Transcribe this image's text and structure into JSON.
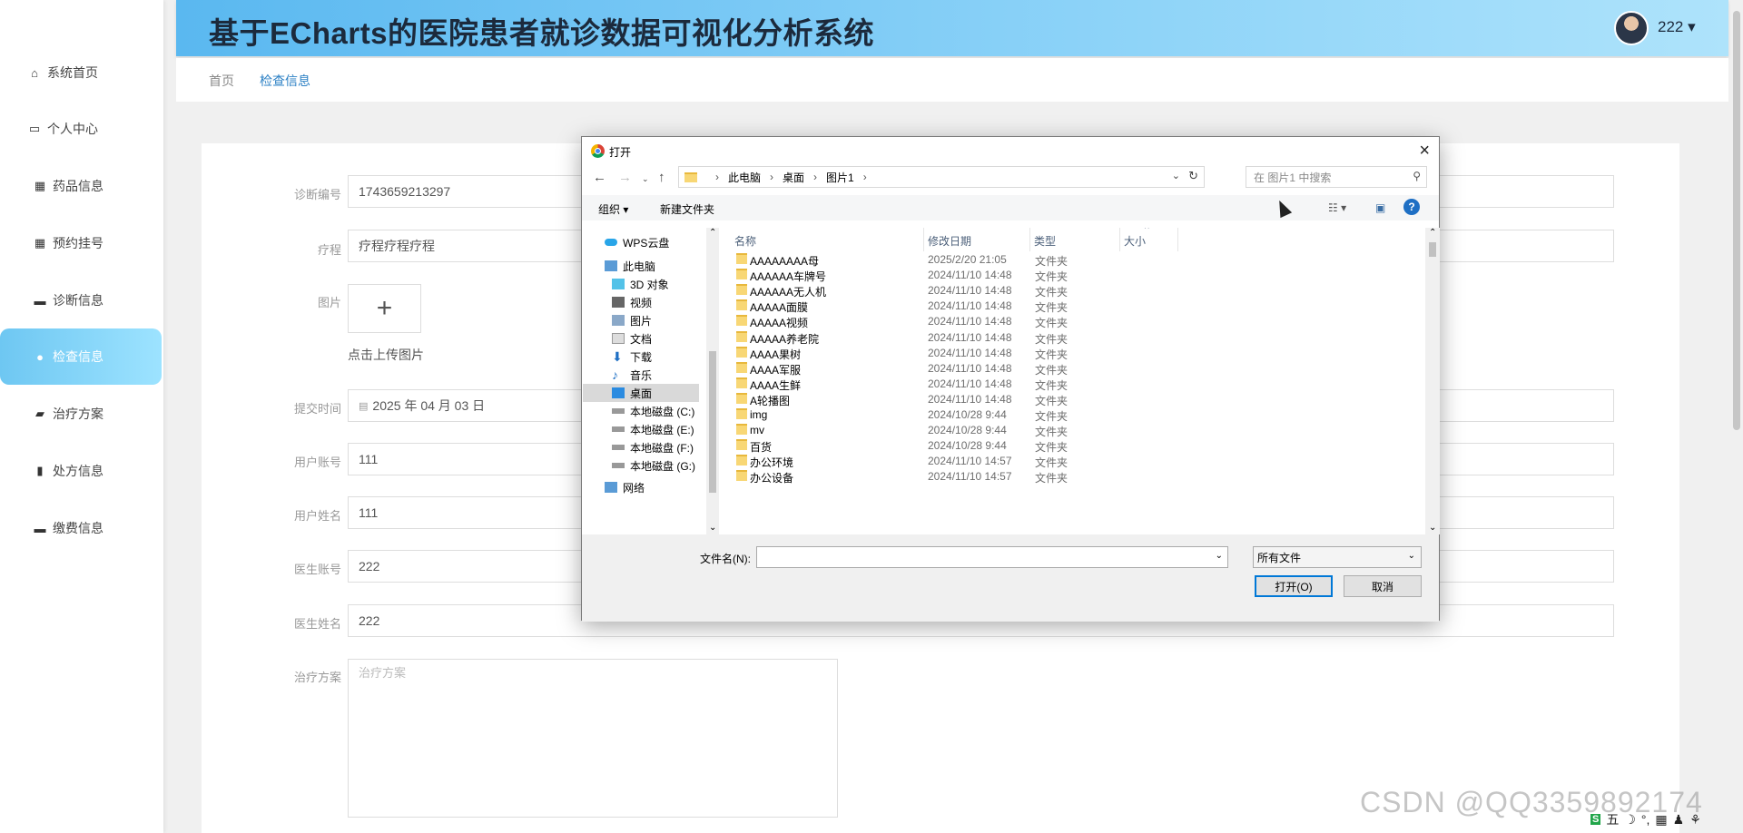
{
  "app": {
    "title": "基于ECharts的医院患者就诊数据可视化分析系统",
    "user": "222 ▾"
  },
  "sidebar": {
    "items": [
      {
        "label": "系统首页",
        "icon": "home-icon"
      },
      {
        "label": "个人中心",
        "icon": "id-card-icon"
      },
      {
        "label": "药品信息",
        "icon": "grid-icon"
      },
      {
        "label": "预约挂号",
        "icon": "grid-icon"
      },
      {
        "label": "诊断信息",
        "icon": "monitor-icon"
      },
      {
        "label": "检查信息",
        "icon": "user-icon",
        "active": true
      },
      {
        "label": "治疗方案",
        "icon": "briefcase-icon"
      },
      {
        "label": "处方信息",
        "icon": "clipboard-icon"
      },
      {
        "label": "缴费信息",
        "icon": "monitor-icon"
      }
    ]
  },
  "breadcrumb": {
    "home": "首页",
    "current": "检查信息"
  },
  "form": {
    "diagnosis_no": {
      "label": "诊断编号",
      "value": "1743659213297"
    },
    "course": {
      "label": "疗程",
      "value": "疗程疗程疗程"
    },
    "image": {
      "label": "图片",
      "plus": "+",
      "tip": "点击上传图片"
    },
    "submit_time": {
      "label": "提交时间",
      "value": "2025 年 04 月 03 日"
    },
    "user_account": {
      "label": "用户账号",
      "value": "111"
    },
    "user_name": {
      "label": "用户姓名",
      "value": "111"
    },
    "doctor_account": {
      "label": "医生账号",
      "value": "222"
    },
    "doctor_name": {
      "label": "医生姓名",
      "value": "222"
    },
    "plan": {
      "label": "治疗方案",
      "placeholder": "治疗方案"
    }
  },
  "dialog": {
    "title": "打开",
    "path": [
      "此电脑",
      "桌面",
      "图片1"
    ],
    "search_placeholder": "在 图片1 中搜索",
    "toolbar": {
      "organize": "组织 ▾",
      "new_folder": "新建文件夹"
    },
    "tree": [
      {
        "label": "WPS云盘",
        "icon": "cloud-icon"
      },
      {
        "label": "此电脑",
        "icon": "computer-icon"
      },
      {
        "label": "3D 对象",
        "icon": "cube-icon"
      },
      {
        "label": "视频",
        "icon": "video-icon"
      },
      {
        "label": "图片",
        "icon": "image-icon"
      },
      {
        "label": "文档",
        "icon": "document-icon"
      },
      {
        "label": "下载",
        "icon": "download-icon"
      },
      {
        "label": "音乐",
        "icon": "music-icon"
      },
      {
        "label": "桌面",
        "icon": "desktop-icon",
        "selected": true
      },
      {
        "label": "本地磁盘 (C:)",
        "icon": "disk-icon"
      },
      {
        "label": "本地磁盘 (E:)",
        "icon": "disk-icon"
      },
      {
        "label": "本地磁盘 (F:)",
        "icon": "disk-icon"
      },
      {
        "label": "本地磁盘 (G:)",
        "icon": "disk-icon"
      },
      {
        "label": "网络",
        "icon": "network-icon"
      }
    ],
    "columns": {
      "name": "名称",
      "date": "修改日期",
      "type": "类型",
      "size": "大小"
    },
    "files": [
      {
        "name": "AAAAAAAA母",
        "date": "2025/2/20 21:05",
        "type": "文件夹"
      },
      {
        "name": "AAAAAA车牌号",
        "date": "2024/11/10 14:48",
        "type": "文件夹"
      },
      {
        "name": "AAAAAA无人机",
        "date": "2024/11/10 14:48",
        "type": "文件夹"
      },
      {
        "name": "AAAAA面膜",
        "date": "2024/11/10 14:48",
        "type": "文件夹"
      },
      {
        "name": "AAAAA视频",
        "date": "2024/11/10 14:48",
        "type": "文件夹"
      },
      {
        "name": "AAAAA养老院",
        "date": "2024/11/10 14:48",
        "type": "文件夹"
      },
      {
        "name": "AAAA果树",
        "date": "2024/11/10 14:48",
        "type": "文件夹"
      },
      {
        "name": "AAAA军服",
        "date": "2024/11/10 14:48",
        "type": "文件夹"
      },
      {
        "name": "AAAA生鲜",
        "date": "2024/11/10 14:48",
        "type": "文件夹"
      },
      {
        "name": "A轮播图",
        "date": "2024/11/10 14:48",
        "type": "文件夹"
      },
      {
        "name": "img",
        "date": "2024/10/28 9:44",
        "type": "文件夹"
      },
      {
        "name": "mv",
        "date": "2024/10/28 9:44",
        "type": "文件夹"
      },
      {
        "name": "百货",
        "date": "2024/10/28 9:44",
        "type": "文件夹"
      },
      {
        "name": "办公环境",
        "date": "2024/11/10 14:57",
        "type": "文件夹"
      },
      {
        "name": "办公设备",
        "date": "2024/11/10 14:57",
        "type": "文件夹"
      }
    ],
    "filename_label": "文件名(N):",
    "filter": "所有文件",
    "open": "打开(O)",
    "cancel": "取消"
  },
  "watermark": "CSDN @QQ3359892174",
  "tray": [
    "五",
    "☽",
    "°,",
    "▦",
    "♟",
    "⚘"
  ]
}
